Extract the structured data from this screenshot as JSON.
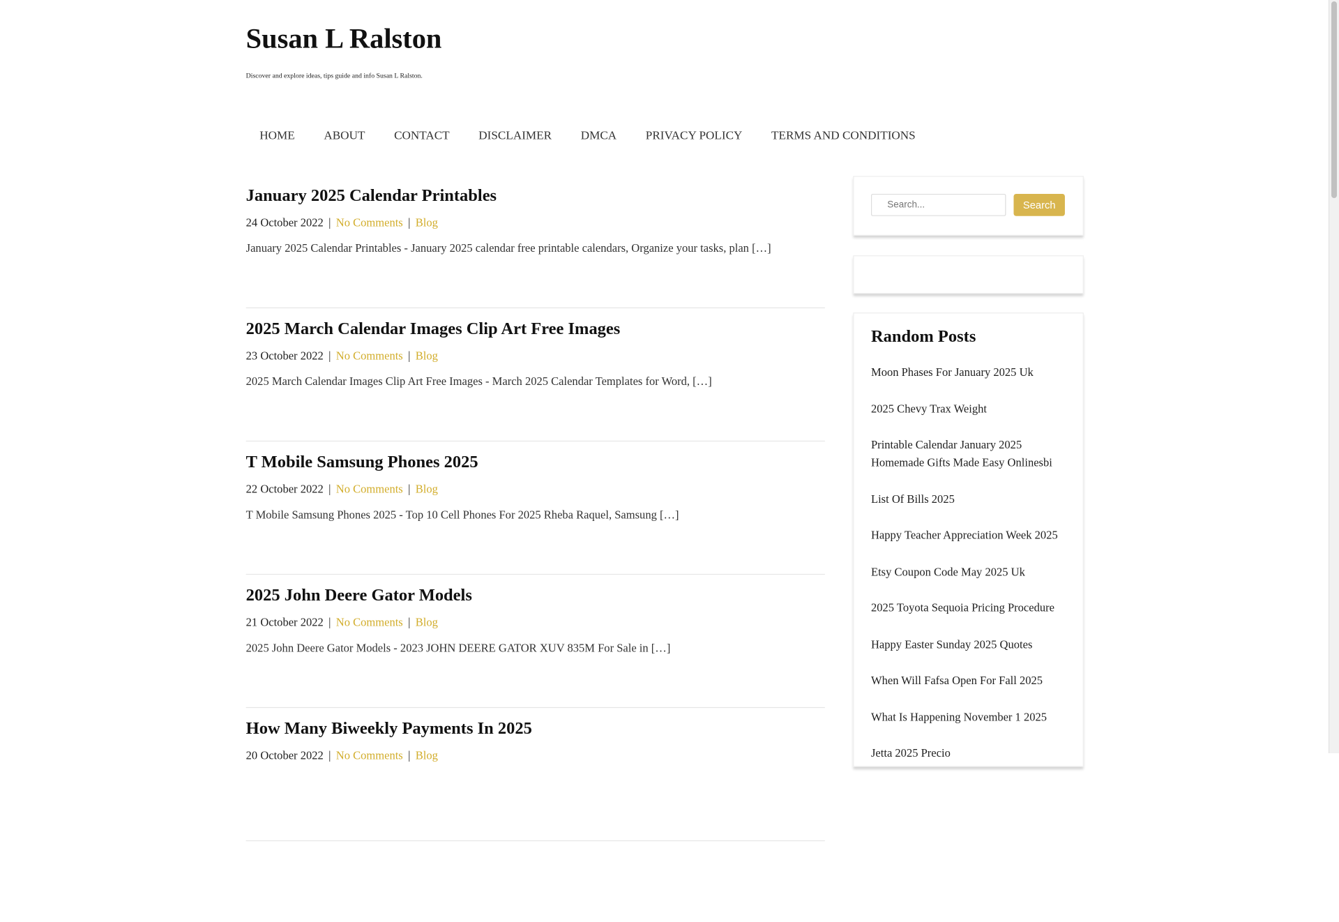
{
  "site": {
    "title": "Susan L Ralston",
    "description": "Discover and explore ideas, tips guide and info Susan L Ralston."
  },
  "nav": {
    "items": [
      {
        "label": "HOME"
      },
      {
        "label": "ABOUT"
      },
      {
        "label": "CONTACT"
      },
      {
        "label": "DISCLAIMER"
      },
      {
        "label": "DMCA"
      },
      {
        "label": "PRIVACY POLICY"
      },
      {
        "label": "TERMS AND CONDITIONS"
      }
    ]
  },
  "posts": [
    {
      "title": "January 2025 Calendar Printables",
      "date": "24 October 2022",
      "comments": "No Comments",
      "category": "Blog",
      "excerpt": "January 2025 Calendar Printables - January 2025 calendar free printable calendars, Organize your tasks, plan […]"
    },
    {
      "title": "2025 March Calendar Images Clip Art Free Images",
      "date": "23 October 2022",
      "comments": "No Comments",
      "category": "Blog",
      "excerpt": "2025 March Calendar Images Clip Art Free Images - March 2025 Calendar Templates for Word, […]"
    },
    {
      "title": "T Mobile Samsung Phones 2025",
      "date": "22 October 2022",
      "comments": "No Comments",
      "category": "Blog",
      "excerpt": "T Mobile Samsung Phones 2025 - Top 10 Cell Phones For 2025 Rheba Raquel, Samsung […]"
    },
    {
      "title": "2025 John Deere Gator Models",
      "date": "21 October 2022",
      "comments": "No Comments",
      "category": "Blog",
      "excerpt": "2025 John Deere Gator Models - 2023 JOHN DEERE GATOR XUV 835M For Sale in […]"
    },
    {
      "title": "How Many Biweekly Payments In 2025",
      "date": "20 October 2022",
      "comments": "No Comments",
      "category": "Blog",
      "excerpt": ""
    }
  ],
  "sidebar": {
    "search": {
      "placeholder": "Search...",
      "button_label": "Search"
    },
    "random_posts": {
      "title": "Random Posts",
      "items": [
        "Moon Phases For January 2025 Uk",
        "2025 Chevy Trax Weight",
        "Printable Calendar January 2025 Homemade Gifts Made Easy Onlinesbi",
        "List Of Bills 2025",
        "Happy Teacher Appreciation Week 2025",
        "Etsy Coupon Code May 2025 Uk",
        "2025 Toyota Sequoia Pricing Procedure",
        "Happy Easter Sunday 2025 Quotes",
        "When Will Fafsa Open For Fall 2025",
        "What Is Happening November 1 2025",
        "Jetta 2025 Precio"
      ]
    }
  },
  "colors": {
    "accent": "#d2ad2b",
    "button": "#d8b54e",
    "text": "#222222"
  }
}
